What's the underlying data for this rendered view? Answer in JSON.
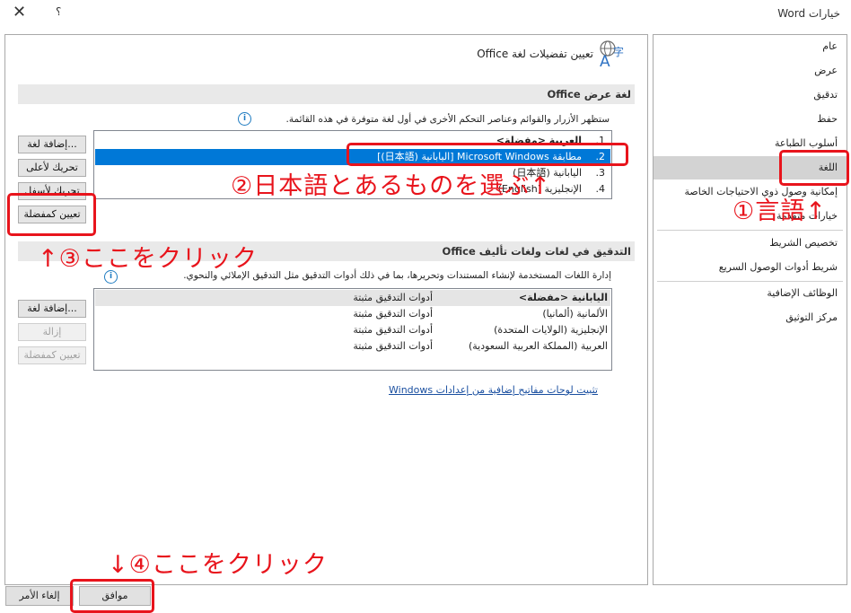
{
  "window": {
    "title": "خيارات Word",
    "help_label": "؟",
    "close_label": "✕"
  },
  "sidebar": {
    "items": [
      {
        "label": "عام"
      },
      {
        "label": "عرض"
      },
      {
        "label": "تدقيق"
      },
      {
        "label": "حفظ"
      },
      {
        "label": "أسلوب الطباعة"
      },
      {
        "label": "اللغة",
        "selected": true
      },
      {
        "label": "إمكانية وصول ذوي الاحتياجات الخاصة"
      },
      {
        "label": "خيارات متقدمة"
      },
      {
        "label": "تخصيص الشريط"
      },
      {
        "label": "شريط أدوات الوصول السريع"
      },
      {
        "label": "الوظائف الإضافية"
      },
      {
        "label": "مركز التوثيق"
      }
    ]
  },
  "main": {
    "page_title": "تعيين تفضيلات لغة Office",
    "display_section": {
      "header": "لغة عرض Office",
      "description": "ستظهر الأزرار والقوائم وعناصر التحكم الأخرى في أول لغة متوفرة في هذه القائمة.",
      "languages": [
        {
          "num": "1.",
          "name": "العربية <مفضلة>"
        },
        {
          "num": "2.",
          "name": "مطابقة Microsoft Windows [اليابانية (日本語)]",
          "selected": true
        },
        {
          "num": "3.",
          "name": "اليابانية (日本語)"
        },
        {
          "num": "4.",
          "name": "الإنجليزية (English)"
        }
      ],
      "buttons": {
        "add": "إضافة لغة...",
        "move_up": "تحريك لأعلى",
        "move_down": "تحريك لأسفل",
        "set_preferred": "تعيين كمفضلة"
      }
    },
    "proofing_section": {
      "header": "التدقيق في لغات ولغات تأليف Office",
      "description": "إدارة اللغات المستخدمة لإنشاء المستندات وتحريرها، بما في ذلك أدوات التدقيق مثل التدقيق الإملائي والنحوي.",
      "languages": [
        {
          "name": "اليابانية <مفضلة>",
          "status": "أدوات التدقيق مثبتة",
          "selected": true
        },
        {
          "name": "الألمانية (ألمانيا)",
          "status": "أدوات التدقيق مثبتة"
        },
        {
          "name": "الإنجليزية (الولايات المتحدة)",
          "status": "أدوات التدقيق مثبتة"
        },
        {
          "name": "العربية (المملكة العربية السعودية)",
          "status": "أدوات التدقيق مثبتة"
        }
      ],
      "buttons": {
        "add": "إضافة لغة...",
        "remove": "إزالة",
        "set_preferred": "تعيين كمفضلة"
      },
      "keyboard_link": "تثبيت لوحات مفاتيح إضافية من إعدادات Windows"
    }
  },
  "footer": {
    "ok_label": "موافق",
    "cancel_label": "إلغاء الأمر"
  },
  "annotations": {
    "step1": "①言語↑",
    "step2": "②日本語とあるものを選ぶ↑",
    "step3": "↑③ここをクリック",
    "step4": "↓④ここをクリック",
    "highlight_color": "#e8141c"
  },
  "colors": {
    "selection_blue": "#0078d7",
    "link_blue": "#1a4fa0",
    "info_blue": "#1e7bc1"
  }
}
